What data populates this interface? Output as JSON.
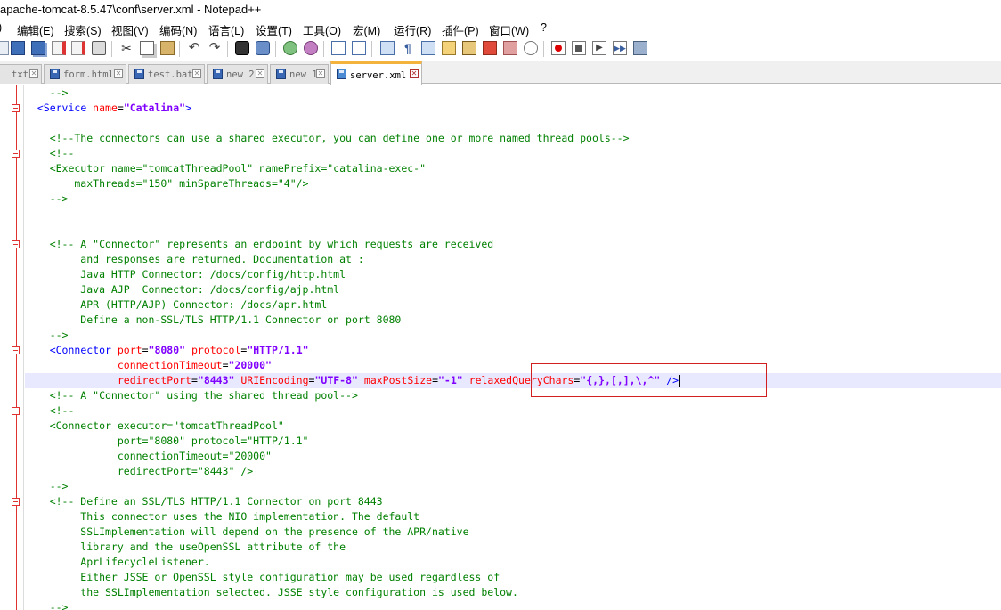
{
  "window": {
    "title": "apache-tomcat-8.5.47\\conf\\server.xml - Notepad++"
  },
  "menu": [
    {
      "label": ")"
    },
    {
      "label": "编辑(E)"
    },
    {
      "label": "搜索(S)"
    },
    {
      "label": "视图(V)"
    },
    {
      "label": "编码(N)"
    },
    {
      "label": "语言(L)"
    },
    {
      "label": "设置(T)"
    },
    {
      "label": "工具(O)"
    },
    {
      "label": "宏(M)"
    },
    {
      "label": "运行(R)"
    },
    {
      "label": "插件(P)"
    },
    {
      "label": "窗口(W)"
    },
    {
      "label": "?"
    }
  ],
  "toolbar_icons": [
    "new-file-icon",
    "open-file-icon",
    "save-icon",
    "save-all-icon",
    "close-icon",
    "close-all-icon",
    "print-icon",
    "cut-icon",
    "copy-icon",
    "paste-icon",
    "undo-icon",
    "redo-icon",
    "find-icon",
    "replace-icon",
    "zoom-in-icon",
    "zoom-out-icon",
    "sync-vertical-icon",
    "sync-horizontal-icon",
    "word-wrap-icon",
    "show-all-chars-icon",
    "indent-guide-icon",
    "document-map-icon",
    "function-list-icon",
    "folder-workspace-icon",
    "monitoring-icon",
    "record-macro-icon",
    "stop-macro-icon",
    "play-macro-icon",
    "run-macro-multiple-icon",
    "save-macro-icon"
  ],
  "tabs": [
    {
      "label": "txt",
      "active": false
    },
    {
      "label": "form.html",
      "active": false
    },
    {
      "label": "test.bat",
      "active": false
    },
    {
      "label": "new 2",
      "active": false
    },
    {
      "label": "new 1",
      "active": false
    },
    {
      "label": "server.xml",
      "active": true
    }
  ],
  "lines": [
    {
      "fold": false,
      "current": false,
      "tokens": [
        {
          "c": "comment",
          "t": "    -->"
        }
      ]
    },
    {
      "fold": true,
      "current": false,
      "tokens": [
        {
          "c": "plain",
          "t": "  "
        },
        {
          "c": "tag",
          "t": "<Service "
        },
        {
          "c": "attr",
          "t": "name"
        },
        {
          "c": "plain",
          "t": "="
        },
        {
          "c": "val",
          "t": "\"Catalina\""
        },
        {
          "c": "tag",
          "t": ">"
        }
      ]
    },
    {
      "fold": false,
      "current": false,
      "tokens": []
    },
    {
      "fold": false,
      "current": false,
      "tokens": [
        {
          "c": "comment",
          "t": "    <!--The connectors can use a shared executor, you can define one or more named thread pools-->"
        }
      ]
    },
    {
      "fold": true,
      "current": false,
      "tokens": [
        {
          "c": "comment",
          "t": "    <!--"
        }
      ]
    },
    {
      "fold": false,
      "current": false,
      "tokens": [
        {
          "c": "comment",
          "t": "    <Executor name=\"tomcatThreadPool\" namePrefix=\"catalina-exec-\""
        }
      ]
    },
    {
      "fold": false,
      "current": false,
      "tokens": [
        {
          "c": "comment",
          "t": "        maxThreads=\"150\" minSpareThreads=\"4\"/>"
        }
      ]
    },
    {
      "fold": false,
      "current": false,
      "tokens": [
        {
          "c": "comment",
          "t": "    -->"
        }
      ]
    },
    {
      "fold": false,
      "current": false,
      "tokens": []
    },
    {
      "fold": false,
      "current": false,
      "tokens": []
    },
    {
      "fold": true,
      "current": false,
      "tokens": [
        {
          "c": "comment",
          "t": "    <!-- A \"Connector\" represents an endpoint by which requests are received"
        }
      ]
    },
    {
      "fold": false,
      "current": false,
      "tokens": [
        {
          "c": "comment",
          "t": "         and responses are returned. Documentation at :"
        }
      ]
    },
    {
      "fold": false,
      "current": false,
      "tokens": [
        {
          "c": "comment",
          "t": "         Java HTTP Connector: /docs/config/http.html"
        }
      ]
    },
    {
      "fold": false,
      "current": false,
      "tokens": [
        {
          "c": "comment",
          "t": "         Java AJP  Connector: /docs/config/ajp.html"
        }
      ]
    },
    {
      "fold": false,
      "current": false,
      "tokens": [
        {
          "c": "comment",
          "t": "         APR (HTTP/AJP) Connector: /docs/apr.html"
        }
      ]
    },
    {
      "fold": false,
      "current": false,
      "tokens": [
        {
          "c": "comment",
          "t": "         Define a non-SSL/TLS HTTP/1.1 Connector on port 8080"
        }
      ]
    },
    {
      "fold": false,
      "current": false,
      "tokens": [
        {
          "c": "comment",
          "t": "    -->"
        }
      ]
    },
    {
      "fold": true,
      "current": false,
      "tokens": [
        {
          "c": "plain",
          "t": "    "
        },
        {
          "c": "tag",
          "t": "<Connector "
        },
        {
          "c": "attr",
          "t": "port"
        },
        {
          "c": "plain",
          "t": "="
        },
        {
          "c": "val",
          "t": "\"8080\""
        },
        {
          "c": "plain",
          "t": " "
        },
        {
          "c": "attr",
          "t": "protocol"
        },
        {
          "c": "plain",
          "t": "="
        },
        {
          "c": "val",
          "t": "\"HTTP/1.1\""
        }
      ]
    },
    {
      "fold": false,
      "current": false,
      "tokens": [
        {
          "c": "plain",
          "t": "               "
        },
        {
          "c": "attr",
          "t": "connectionTimeout"
        },
        {
          "c": "plain",
          "t": "="
        },
        {
          "c": "val",
          "t": "\"20000\""
        }
      ]
    },
    {
      "fold": false,
      "current": true,
      "tokens": [
        {
          "c": "plain",
          "t": "               "
        },
        {
          "c": "attr",
          "t": "redirectPort"
        },
        {
          "c": "plain",
          "t": "="
        },
        {
          "c": "val",
          "t": "\"8443\""
        },
        {
          "c": "plain",
          "t": " "
        },
        {
          "c": "attr",
          "t": "URIEncoding"
        },
        {
          "c": "plain",
          "t": "="
        },
        {
          "c": "val",
          "t": "\"UTF-8\""
        },
        {
          "c": "plain",
          "t": " "
        },
        {
          "c": "attr",
          "t": "maxPostSize"
        },
        {
          "c": "plain",
          "t": "="
        },
        {
          "c": "val",
          "t": "\"-1\""
        },
        {
          "c": "plain",
          "t": " "
        },
        {
          "c": "attr",
          "t": "relaxedQueryChars"
        },
        {
          "c": "plain",
          "t": "="
        },
        {
          "c": "val",
          "t": "\"{,},[,],\\,^\""
        },
        {
          "c": "plain",
          "t": " "
        },
        {
          "c": "tag",
          "t": "/>"
        }
      ]
    },
    {
      "fold": false,
      "current": false,
      "tokens": [
        {
          "c": "comment",
          "t": "    <!-- A \"Connector\" using the shared thread pool-->"
        }
      ]
    },
    {
      "fold": true,
      "current": false,
      "tokens": [
        {
          "c": "comment",
          "t": "    <!--"
        }
      ]
    },
    {
      "fold": false,
      "current": false,
      "tokens": [
        {
          "c": "comment",
          "t": "    <Connector executor=\"tomcatThreadPool\""
        }
      ]
    },
    {
      "fold": false,
      "current": false,
      "tokens": [
        {
          "c": "comment",
          "t": "               port=\"8080\" protocol=\"HTTP/1.1\""
        }
      ]
    },
    {
      "fold": false,
      "current": false,
      "tokens": [
        {
          "c": "comment",
          "t": "               connectionTimeout=\"20000\""
        }
      ]
    },
    {
      "fold": false,
      "current": false,
      "tokens": [
        {
          "c": "comment",
          "t": "               redirectPort=\"8443\" />"
        }
      ]
    },
    {
      "fold": false,
      "current": false,
      "tokens": [
        {
          "c": "comment",
          "t": "    -->"
        }
      ]
    },
    {
      "fold": true,
      "current": false,
      "tokens": [
        {
          "c": "comment",
          "t": "    <!-- Define an SSL/TLS HTTP/1.1 Connector on port 8443"
        }
      ]
    },
    {
      "fold": false,
      "current": false,
      "tokens": [
        {
          "c": "comment",
          "t": "         This connector uses the NIO implementation. The default"
        }
      ]
    },
    {
      "fold": false,
      "current": false,
      "tokens": [
        {
          "c": "comment",
          "t": "         SSLImplementation will depend on the presence of the APR/native"
        }
      ]
    },
    {
      "fold": false,
      "current": false,
      "tokens": [
        {
          "c": "comment",
          "t": "         library and the useOpenSSL attribute of the"
        }
      ]
    },
    {
      "fold": false,
      "current": false,
      "tokens": [
        {
          "c": "comment",
          "t": "         AprLifecycleListener."
        }
      ]
    },
    {
      "fold": false,
      "current": false,
      "tokens": [
        {
          "c": "comment",
          "t": "         Either JSSE or OpenSSL style configuration may be used regardless of"
        }
      ]
    },
    {
      "fold": false,
      "current": false,
      "tokens": [
        {
          "c": "comment",
          "t": "         the SSLImplementation selected. JSSE style configuration is used below."
        }
      ]
    },
    {
      "fold": false,
      "current": false,
      "tokens": [
        {
          "c": "comment",
          "t": "    -->"
        }
      ]
    }
  ]
}
